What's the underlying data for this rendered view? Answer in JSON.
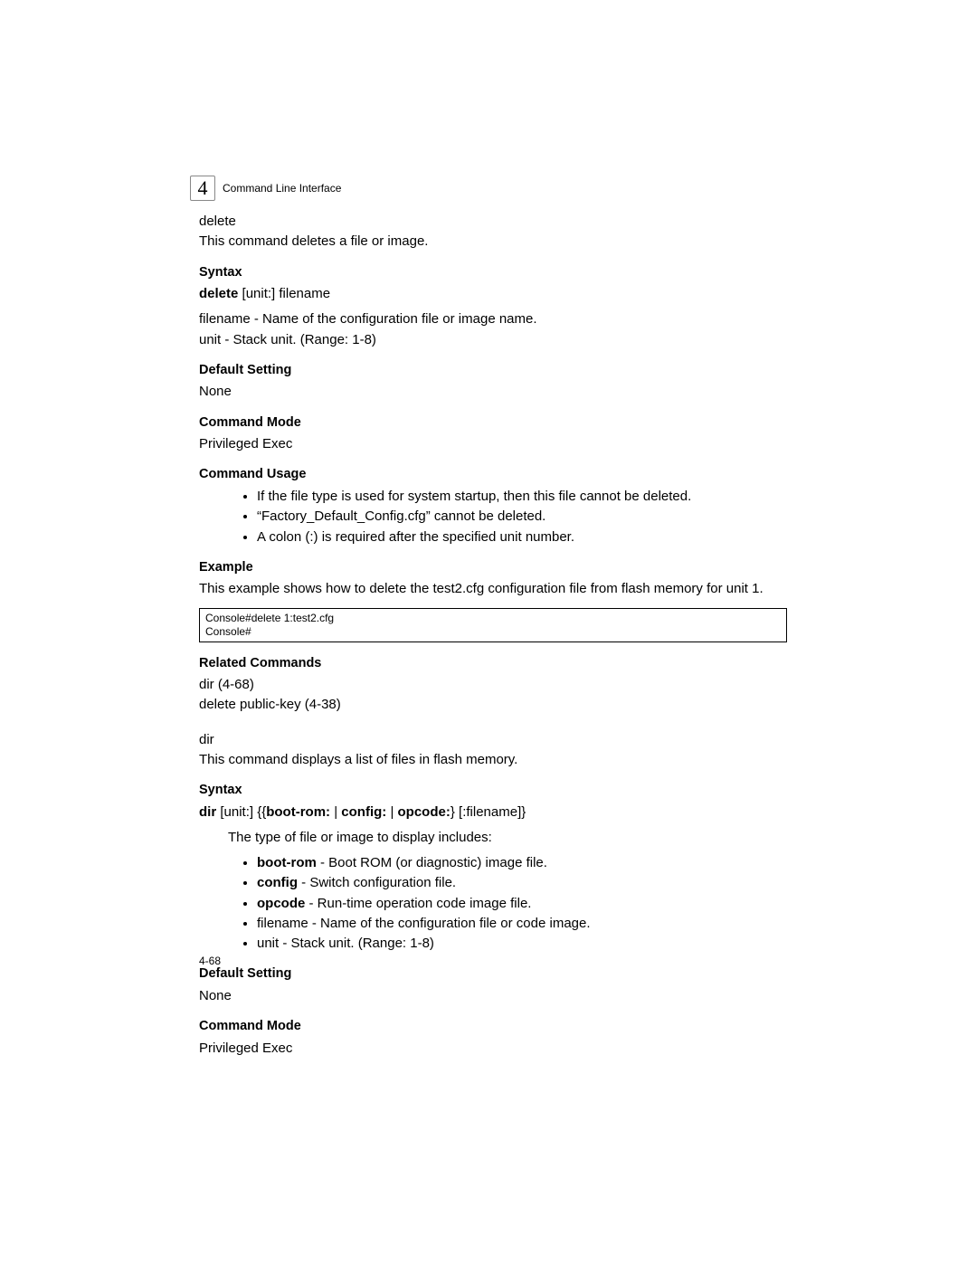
{
  "chapter": {
    "number": "4",
    "label": "Command Line Interface"
  },
  "delete": {
    "title": "delete",
    "intro": "This command deletes a file or image.",
    "syntax_head": "Syntax",
    "syntax_cmd_bold": "delete ",
    "syntax_cmd_rest": "[unit:] filename",
    "syntax_desc1": "filename - Name of the configuration file or image name.",
    "syntax_desc2": "unit - Stack unit. (Range: 1-8)",
    "default_head": "Default Setting",
    "default_text": "None",
    "mode_head": "Command Mode",
    "mode_text": "Privileged Exec",
    "usage_head": "Command Usage",
    "usage_items": [
      "If the file type is used for system startup, then this file cannot be deleted.",
      "“Factory_Default_Config.cfg” cannot be deleted.",
      "A colon (:) is required after the specified unit number."
    ],
    "example_head": "Example",
    "example_text": "This example shows how to delete the test2.cfg configuration file from flash memory for unit 1.",
    "example_code": "Console#delete 1:test2.cfg\nConsole#",
    "related_head": "Related Commands",
    "related_lines": [
      "dir (4-68)",
      "delete public-key (4-38)"
    ]
  },
  "dir": {
    "title": "dir",
    "intro": "This command displays a list of files in flash memory.",
    "syntax_head": "Syntax",
    "syntax_parts": {
      "p1": "dir ",
      "p2": "[unit:] {{",
      "p3": "boot-rom: ",
      "p4": "| ",
      "p5": "config: ",
      "p6": "| ",
      "p7": "opcode:",
      "p8": "} [:filename]}"
    },
    "type_intro": "The type of file or image to display includes:",
    "type_items": [
      {
        "bold": "boot-rom",
        "rest": " - Boot ROM (or diagnostic) image file."
      },
      {
        "bold": "config",
        "rest": " - Switch configuration file."
      },
      {
        "bold": "opcode",
        "rest": " - Run-time operation code image file."
      },
      {
        "bold": "",
        "rest": "filename - Name of the configuration file or code image."
      },
      {
        "bold": "",
        "rest": "unit - Stack unit. (Range: 1-8)"
      }
    ],
    "default_head": "Default Setting",
    "default_text": "None",
    "mode_head": "Command Mode",
    "mode_text": "Privileged Exec"
  },
  "page_num": "4-68"
}
